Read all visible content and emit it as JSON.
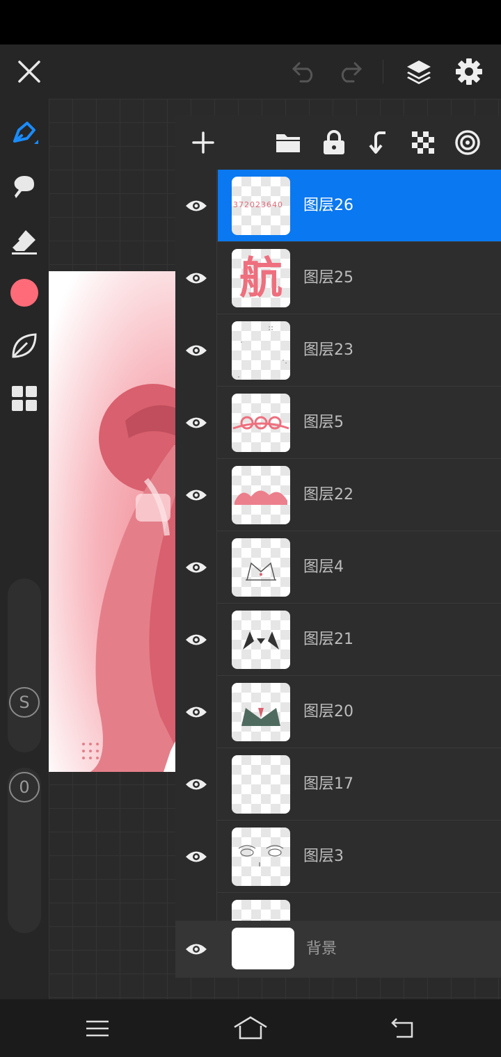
{
  "toolbar": {
    "close_icon": "close-icon",
    "undo_icon": "undo-icon",
    "redo_icon": "redo-icon",
    "layers_icon": "layers-icon",
    "settings_icon": "gear-icon"
  },
  "tools": {
    "brush": "brush-icon",
    "smudge": "smudge-icon",
    "eraser": "eraser-icon",
    "color": "#ff6b78",
    "leaf": "leaf-icon",
    "grid": "grid-icon",
    "size_label": "S",
    "opacity_label": "0"
  },
  "layer_actions": [
    "add-layer",
    "folder",
    "lock",
    "merge-down",
    "transparency",
    "blend"
  ],
  "layers": [
    {
      "name": "图层26",
      "selected": true,
      "thumb_text": "372023640"
    },
    {
      "name": "图层25",
      "selected": false,
      "thumb_text": "航"
    },
    {
      "name": "图层23",
      "selected": false
    },
    {
      "name": "图层5",
      "selected": false
    },
    {
      "name": "图层22",
      "selected": false
    },
    {
      "name": "图层4",
      "selected": false
    },
    {
      "name": "图层21",
      "selected": false
    },
    {
      "name": "图层20",
      "selected": false
    },
    {
      "name": "图层17",
      "selected": false
    },
    {
      "name": "图层3",
      "selected": false
    }
  ],
  "background_layer": {
    "name": "背景"
  },
  "colors": {
    "accent": "#0a78f0",
    "primary_color": "#ff6b78"
  }
}
